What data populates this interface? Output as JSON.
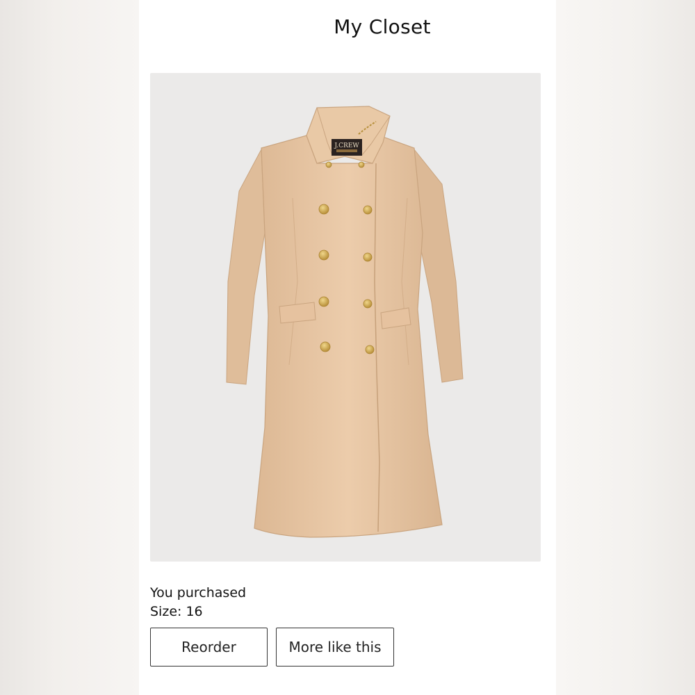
{
  "header": {
    "title": "My Closet"
  },
  "product": {
    "image_icon": "coat-image",
    "brand_label": "J.CREW",
    "purchase_status": "You purchased",
    "size_text": "Size: 16"
  },
  "actions": {
    "reorder_label": "Reorder",
    "more_like_this_label": "More like this"
  },
  "colors": {
    "coat": "#e8c8a6",
    "buttons": "#c9a24a",
    "image_bg": "#ebeae9"
  }
}
